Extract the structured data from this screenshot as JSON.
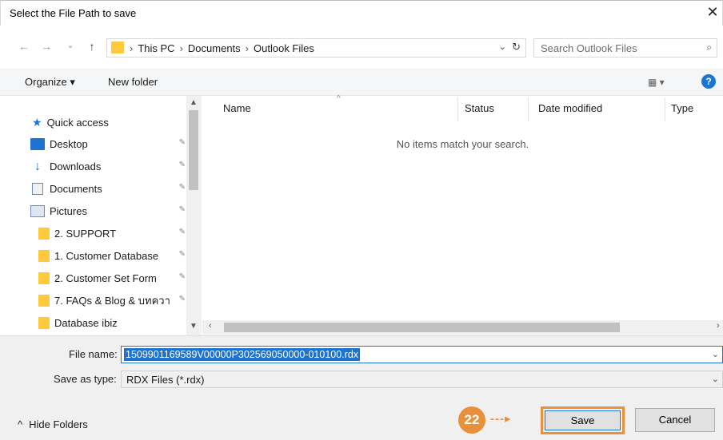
{
  "window": {
    "title": "Select the File Path to save",
    "close": "✕"
  },
  "address": {
    "back": "←",
    "forward": "→",
    "recent": "⌄",
    "up": "↑",
    "crumbs": [
      "This PC",
      "Documents",
      "Outlook Files"
    ],
    "separator": "›",
    "dropdown": "⌄",
    "refresh": "↻"
  },
  "search": {
    "placeholder": "Search Outlook Files",
    "icon": "⌕"
  },
  "toolbar": {
    "organize": "Organize ▾",
    "new_folder": "New folder",
    "view": "▦ ▾",
    "help": "?"
  },
  "nav": {
    "quick_access": "Quick access",
    "items": [
      {
        "label": "Desktop",
        "icon": "desktop-icon",
        "pinned": true
      },
      {
        "label": "Downloads",
        "icon": "download-icon",
        "pinned": true
      },
      {
        "label": "Documents",
        "icon": "document-icon",
        "pinned": true
      },
      {
        "label": "Pictures",
        "icon": "pictures-icon",
        "pinned": true
      },
      {
        "label": "2. SUPPORT",
        "icon": "folder-icon",
        "pinned": true
      },
      {
        "label": "1. Customer Database",
        "icon": "folder-icon",
        "pinned": true
      },
      {
        "label": "2. Customer Set Form",
        "icon": "folder-icon",
        "pinned": true
      },
      {
        "label": "7. FAQs & Blog & บทควา",
        "icon": "folder-icon",
        "pinned": true
      },
      {
        "label": "Database ibiz",
        "icon": "folder-icon",
        "pinned": false
      }
    ],
    "pin_glyph": "📌"
  },
  "columns": {
    "name": "Name",
    "status": "Status",
    "date_modified": "Date modified",
    "type": "Type"
  },
  "empty_message": "No items match your search.",
  "form": {
    "file_name_label": "File name:",
    "file_name_value": "1509901169589V00000P302569050000-010100.rdx",
    "save_type_label": "Save as type:",
    "save_type_value": "RDX Files (*.rdx)"
  },
  "footer": {
    "hide_folders": "Hide Folders",
    "hide_caret": "^",
    "save": "Save",
    "cancel": "Cancel",
    "step_badge": "22",
    "step_arrow": "---▸"
  },
  "colors": {
    "accent": "#1e73d0",
    "highlight": "#e8903a",
    "folder": "#ffc83d"
  }
}
